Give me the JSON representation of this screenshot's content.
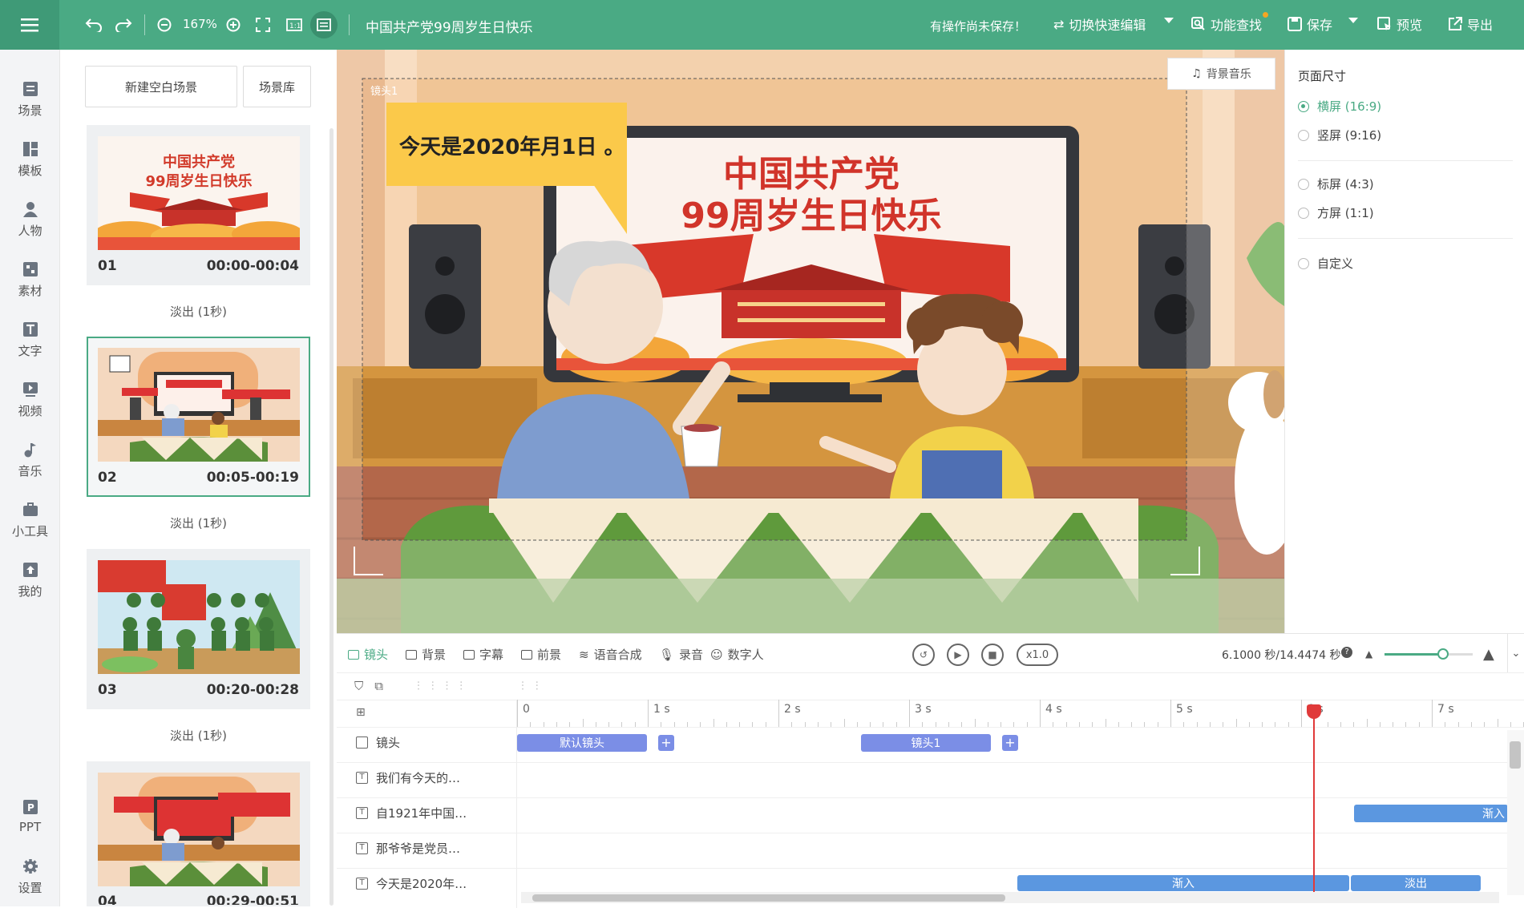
{
  "topbar": {
    "zoom": "167%",
    "doc_title": "中国共产党99周岁生日快乐",
    "unsaved": "有操作尚未保存！",
    "switch_edit": "切换快速编辑",
    "find_feature": "功能查找",
    "save": "保存",
    "preview": "预览",
    "export": "导出"
  },
  "rail": {
    "items": [
      {
        "label": "场景",
        "icon": "scene-icon"
      },
      {
        "label": "模板",
        "icon": "template-icon"
      },
      {
        "label": "人物",
        "icon": "person-icon"
      },
      {
        "label": "素材",
        "icon": "material-icon"
      },
      {
        "label": "文字",
        "icon": "text-icon"
      },
      {
        "label": "视频",
        "icon": "video-icon"
      },
      {
        "label": "音乐",
        "icon": "music-icon"
      },
      {
        "label": "小工具",
        "icon": "toolbox-icon"
      },
      {
        "label": "我的",
        "icon": "upload-icon"
      }
    ],
    "bottom": [
      {
        "label": "PPT",
        "icon": "ppt-icon"
      },
      {
        "label": "设置",
        "icon": "gear-icon"
      }
    ]
  },
  "scenes": {
    "new_blank": "新建空白场景",
    "library": "场景库",
    "items": [
      {
        "num": "01",
        "time": "00:00-00:04",
        "transition": "淡出 (1秒)",
        "thumb_title_1": "中国共产党",
        "thumb_title_2": "99周岁生日快乐"
      },
      {
        "num": "02",
        "time": "00:05-00:19",
        "transition": "淡出 (1秒)"
      },
      {
        "num": "03",
        "time": "00:20-00:28",
        "transition": "淡出 (1秒)"
      },
      {
        "num": "04",
        "time": "00:29-00:51"
      }
    ]
  },
  "canvas": {
    "bgm": "背景音乐",
    "camera_label": "镜头1",
    "caption": "今天是2020年月1日 。",
    "tv_title_1": "中国共产党",
    "tv_title_2": "99周岁生日快乐"
  },
  "right_panel": {
    "title": "页面尺寸",
    "options": [
      {
        "label": "横屏  (16:9)",
        "selected": true
      },
      {
        "label": "竖屏  (9:16)",
        "selected": false
      },
      {
        "label": "标屏  (4:3)",
        "selected": false
      },
      {
        "label": "方屏  (1:1)",
        "selected": false
      },
      {
        "label": "自定义",
        "selected": false
      }
    ]
  },
  "timeline": {
    "tabs": [
      "镜头",
      "背景",
      "字幕",
      "前景",
      "语音合成",
      "录音",
      "数字人"
    ],
    "speed": "x1.0",
    "time_display": "6.1000 秒/14.4474 秒",
    "ticks": [
      "0",
      "1 s",
      "2 s",
      "3 s",
      "4 s",
      "5 s",
      "6 s",
      "7 s"
    ],
    "tracks": [
      {
        "label": "镜头",
        "clips": [
          {
            "text": "默认镜头"
          },
          {
            "text": "镜头1"
          }
        ]
      },
      {
        "label": "我们有今天的…"
      },
      {
        "label": "自1921年中国…",
        "clips": [
          {
            "text": "渐入"
          }
        ]
      },
      {
        "label": "那爷爷是党员…"
      },
      {
        "label": "今天是2020年…",
        "clips": [
          {
            "text": "渐入"
          },
          {
            "text": "淡出"
          }
        ]
      }
    ],
    "playhead_seconds": 6.1,
    "total_seconds": 14.4474
  },
  "colors": {
    "accent": "#4aaa84",
    "clip_purple": "#7b8ee6",
    "clip_blue": "#5b97e0",
    "playhead": "#e03a3a"
  }
}
